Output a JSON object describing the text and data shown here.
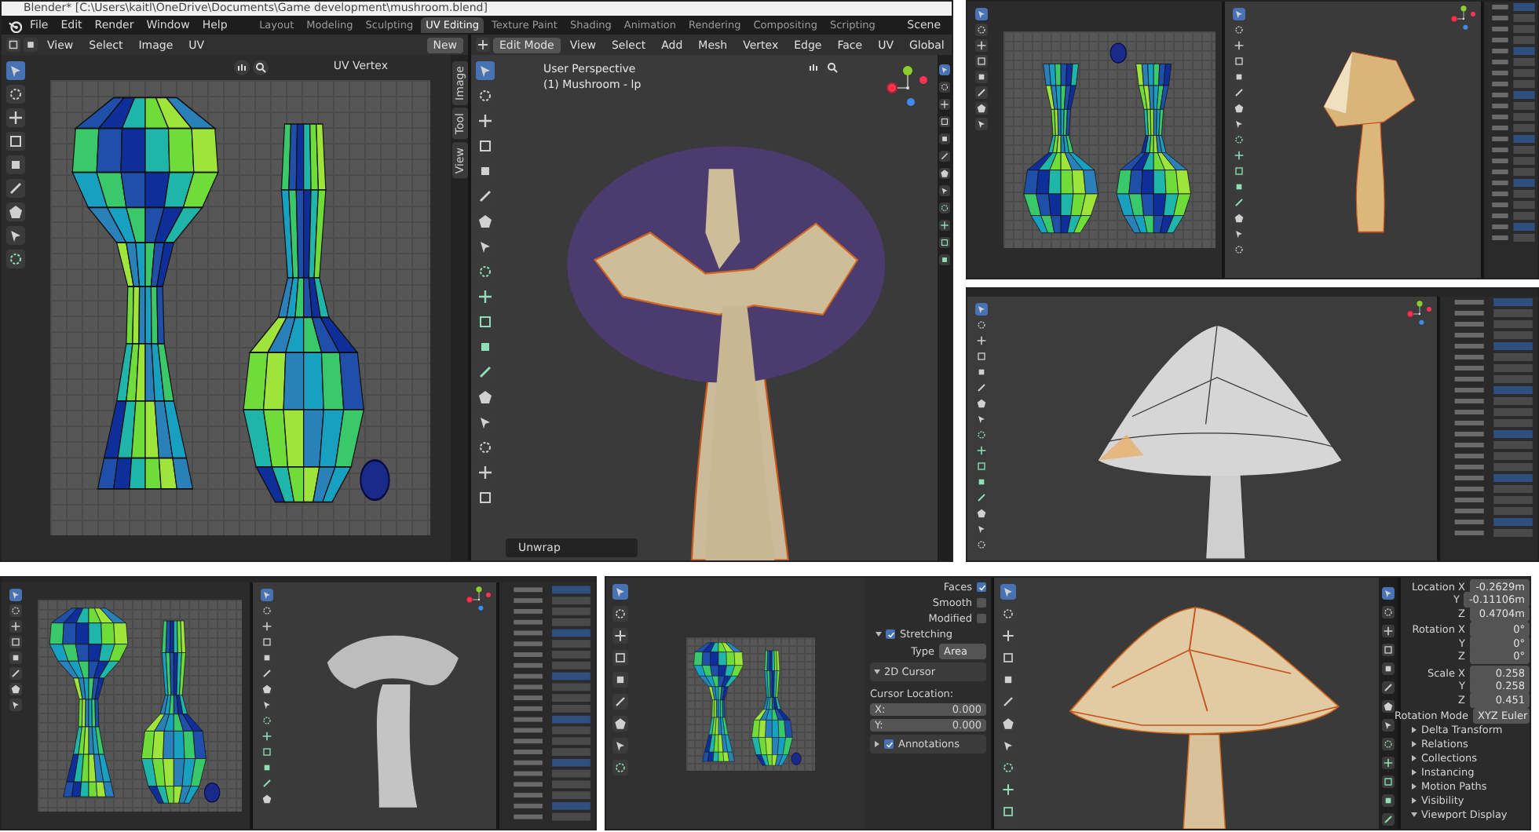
{
  "main_window": {
    "title": "Blender* [C:\\Users\\kaitl\\OneDrive\\Documents\\Game development\\mushroom.blend]",
    "menu": [
      "File",
      "Edit",
      "Render",
      "Window",
      "Help"
    ],
    "workspaces": [
      {
        "label": "Layout",
        "selected": false
      },
      {
        "label": "Modeling",
        "selected": false
      },
      {
        "label": "Sculpting",
        "selected": false
      },
      {
        "label": "UV Editing",
        "selected": true
      },
      {
        "label": "Texture Paint",
        "selected": false
      },
      {
        "label": "Shading",
        "selected": false
      },
      {
        "label": "Animation",
        "selected": false
      },
      {
        "label": "Rendering",
        "selected": false
      },
      {
        "label": "Compositing",
        "selected": false
      },
      {
        "label": "Scripting",
        "selected": false
      }
    ],
    "scene": "Scene",
    "uv_editor": {
      "menu": [
        "View",
        "Select",
        "Image",
        "UV"
      ],
      "new_button": "New",
      "sidebar_title": "UV Vertex",
      "side_tabs": [
        "Image",
        "Tool",
        "View"
      ]
    },
    "viewport": {
      "mode": "Edit Mode",
      "menu": [
        "View",
        "Select",
        "Add",
        "Mesh",
        "Vertex",
        "Edge",
        "Face",
        "UV"
      ],
      "orientation": "Global",
      "perspective": "User Perspective",
      "object": "(1) Mushroom - lp",
      "last_operator": "Unwrap"
    }
  },
  "detail_view": {
    "overlays": [
      {
        "label": "Faces",
        "checked": true
      },
      {
        "label": "Smooth",
        "checked": false
      },
      {
        "label": "Modified",
        "checked": false
      }
    ],
    "stretching": {
      "label": "Stretching",
      "checked": true,
      "type_label": "Type",
      "type_value": "Area"
    },
    "cursor_panel": {
      "title": "2D Cursor",
      "location_label": "Cursor Location:",
      "fields": [
        {
          "label": "X:",
          "value": "0.000"
        },
        {
          "label": "Y:",
          "value": "0.000"
        }
      ]
    },
    "annotations": {
      "label": "Annotations",
      "checked": true
    },
    "transform_groups": [
      {
        "rows": [
          {
            "label": "Location X",
            "value": "-0.2629m"
          },
          {
            "label": "Y",
            "value": "-0.11106m"
          },
          {
            "label": "Z",
            "value": "0.4704m"
          }
        ]
      },
      {
        "rows": [
          {
            "label": "Rotation X",
            "value": "0°"
          },
          {
            "label": "Y",
            "value": "0°"
          },
          {
            "label": "Z",
            "value": "0°"
          }
        ]
      },
      {
        "rows": [
          {
            "label": "Scale X",
            "value": "0.258"
          },
          {
            "label": "Y",
            "value": "0.258"
          },
          {
            "label": "Z",
            "value": "0.451"
          }
        ]
      }
    ],
    "rotation_mode": {
      "label": "Rotation Mode",
      "value": "XYZ Euler"
    },
    "sections": [
      {
        "label": "Delta Transform",
        "expanded": false
      },
      {
        "label": "Relations",
        "expanded": false
      },
      {
        "label": "Collections",
        "expanded": false
      },
      {
        "label": "Instancing",
        "expanded": false
      },
      {
        "label": "Motion Paths",
        "expanded": false
      },
      {
        "label": "Visibility",
        "expanded": false
      },
      {
        "label": "Viewport Display",
        "expanded": true
      }
    ]
  }
}
